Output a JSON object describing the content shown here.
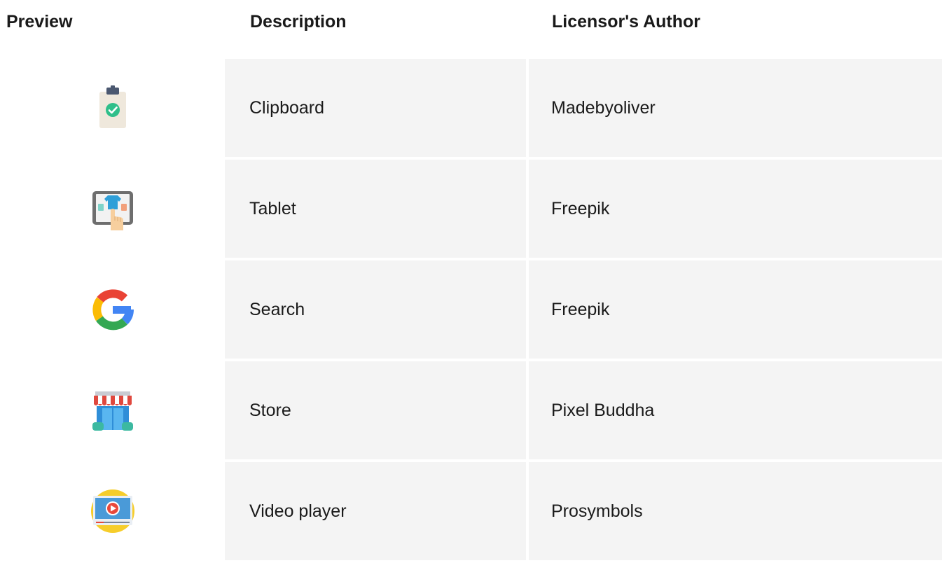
{
  "table": {
    "headers": {
      "preview": "Preview",
      "description": "Description",
      "author": "Licensor's Author"
    },
    "rows": [
      {
        "icon": "clipboard-icon",
        "description": "Clipboard",
        "author": "Madebyoliver"
      },
      {
        "icon": "tablet-icon",
        "description": "Tablet",
        "author": "Freepik"
      },
      {
        "icon": "google-search-icon",
        "description": "Search",
        "author": "Freepik"
      },
      {
        "icon": "store-icon",
        "description": "Store",
        "author": "Pixel Buddha"
      },
      {
        "icon": "video-player-icon",
        "description": "Video player",
        "author": "Prosymbols"
      }
    ]
  },
  "colors": {
    "cell_background": "#f4f4f4",
    "text": "#1a1a1a"
  }
}
